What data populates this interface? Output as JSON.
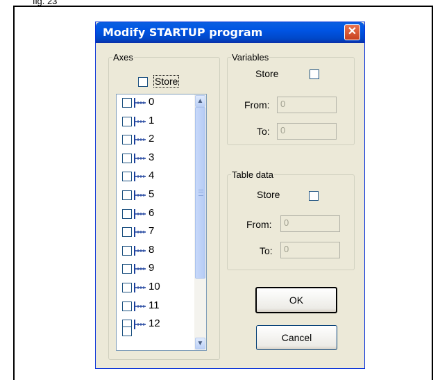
{
  "caption": "fig. 23",
  "dialog": {
    "title": "Modify STARTUP program",
    "close_icon": "close-icon"
  },
  "axes": {
    "legend": "Axes",
    "store_label": "Store",
    "store_checked": false,
    "items": [
      {
        "label": "0"
      },
      {
        "label": "1"
      },
      {
        "label": "2"
      },
      {
        "label": "3"
      },
      {
        "label": "4"
      },
      {
        "label": "5"
      },
      {
        "label": "6"
      },
      {
        "label": "7"
      },
      {
        "label": "8"
      },
      {
        "label": "9"
      },
      {
        "label": "10"
      },
      {
        "label": "11"
      },
      {
        "label": "12"
      }
    ]
  },
  "variables": {
    "legend": "Variables",
    "store_label": "Store",
    "store_checked": false,
    "from_label": "From:",
    "from_value": "0",
    "to_label": "To:",
    "to_value": "0"
  },
  "table_data": {
    "legend": "Table data",
    "store_label": "Store",
    "store_checked": false,
    "from_label": "From:",
    "from_value": "0",
    "to_label": "To:",
    "to_value": "0"
  },
  "buttons": {
    "ok": "OK",
    "cancel": "Cancel"
  },
  "colors": {
    "dialog_bg": "#ECE9D8",
    "titlebar": "#0054E3",
    "close_button": "#E0552F"
  }
}
